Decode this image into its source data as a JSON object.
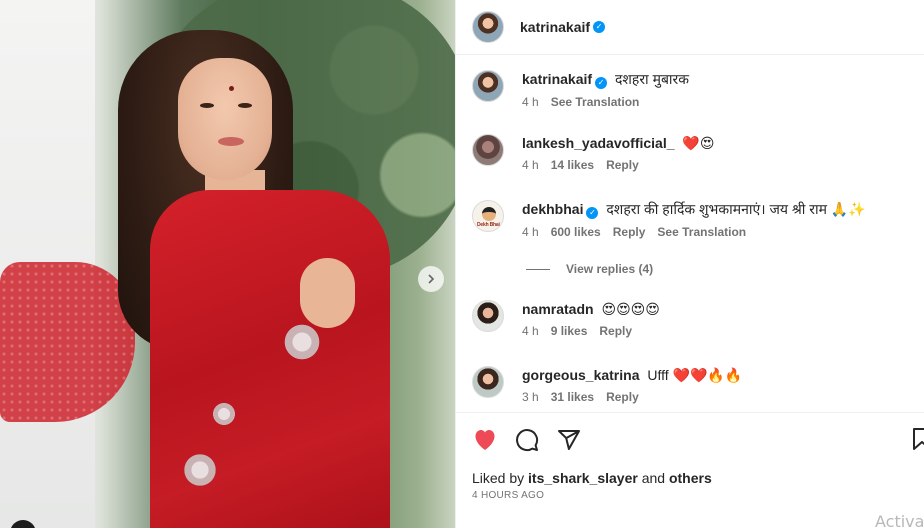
{
  "post": {
    "author": "katrinakaif",
    "caption": "दशहरा मुबारक",
    "caption_time": "4 h",
    "caption_translate": "See Translation"
  },
  "comments": [
    {
      "user": "lankesh_yadavofficial_",
      "text": "❤️😍",
      "time": "4 h",
      "likes": "14 likes",
      "reply": "Reply"
    },
    {
      "user": "dekhbhai",
      "verified": true,
      "text": "दशहरा की हार्दिक शुभकामनाएं। जय श्री राम 🙏✨",
      "time": "4 h",
      "likes": "600 likes",
      "reply": "Reply",
      "translate": "See Translation",
      "avatar_tag": "Dekh Bhai",
      "view_replies": "View replies (4)"
    },
    {
      "user": "namratadn",
      "text": "😍😍😍😍",
      "time": "4 h",
      "likes": "9 likes",
      "reply": "Reply"
    },
    {
      "user": "gorgeous_katrina",
      "text": "Ufff ❤️❤️🔥🔥",
      "time": "3 h",
      "likes": "31 likes",
      "reply": "Reply"
    }
  ],
  "footer": {
    "liked_prefix": "Liked by",
    "liked_user": "its_shark_slayer",
    "liked_and": "and",
    "liked_others": "others",
    "timestamp": "4 HOURS AGO"
  },
  "overlay": {
    "activate": "Activa"
  },
  "icons": {
    "like": "heart-filled-icon",
    "comment": "comment-icon",
    "share": "share-icon",
    "save": "bookmark-icon",
    "carousel": "chevron-right-icon",
    "verified": "verified-badge-icon"
  },
  "colors": {
    "like": "#ed4956",
    "verified": "#0095f6",
    "muted": "#737373",
    "text": "#262626"
  }
}
